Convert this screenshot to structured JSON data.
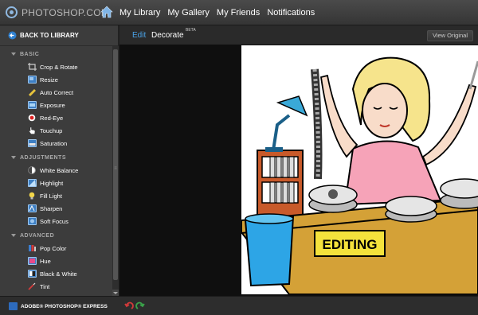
{
  "header": {
    "logo_text": "PHOTOSHOP.COM",
    "nav": [
      "My Library",
      "My Gallery",
      "My Friends",
      "Notifications"
    ]
  },
  "sidebar": {
    "back_label": "BACK TO LIBRARY",
    "groups": [
      {
        "label": "BASIC",
        "items": [
          {
            "label": "Crop & Rotate",
            "icon": "crop-rotate-icon"
          },
          {
            "label": "Resize",
            "icon": "resize-icon"
          },
          {
            "label": "Auto Correct",
            "icon": "auto-correct-icon"
          },
          {
            "label": "Exposure",
            "icon": "exposure-icon"
          },
          {
            "label": "Red-Eye",
            "icon": "red-eye-icon"
          },
          {
            "label": "Touchup",
            "icon": "touchup-icon"
          },
          {
            "label": "Saturation",
            "icon": "saturation-icon"
          }
        ]
      },
      {
        "label": "ADJUSTMENTS",
        "items": [
          {
            "label": "White Balance",
            "icon": "white-balance-icon"
          },
          {
            "label": "Highlight",
            "icon": "highlight-icon"
          },
          {
            "label": "Fill Light",
            "icon": "fill-light-icon"
          },
          {
            "label": "Sharpen",
            "icon": "sharpen-icon"
          },
          {
            "label": "Soft Focus",
            "icon": "soft-focus-icon"
          }
        ]
      },
      {
        "label": "ADVANCED",
        "items": [
          {
            "label": "Pop Color",
            "icon": "pop-color-icon"
          },
          {
            "label": "Hue",
            "icon": "hue-icon"
          },
          {
            "label": "Black & White",
            "icon": "black-white-icon"
          },
          {
            "label": "Tint",
            "icon": "tint-icon"
          }
        ]
      }
    ]
  },
  "editor": {
    "tab_edit": "Edit",
    "tab_decorate": "Decorate",
    "beta": "BETA",
    "view_original": "View Original"
  },
  "footer": {
    "brand": "ADOBE® PHOTOSHOP® EXPRESS"
  },
  "image": {
    "sign_text": "EDITING"
  },
  "colors": {
    "accent_blue": "#4aa3e8",
    "desk": "#d4a137",
    "shirt": "#f6a3b8",
    "hair": "#f6e48c"
  }
}
